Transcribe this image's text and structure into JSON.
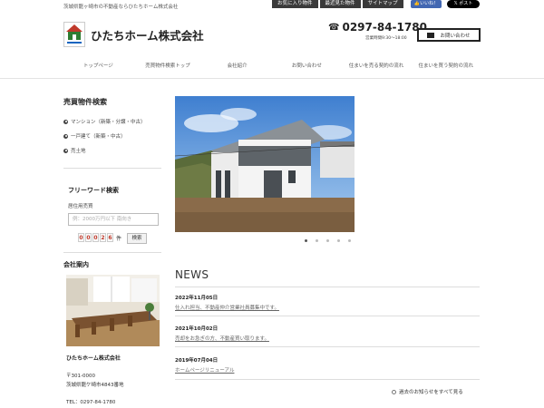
{
  "header": {
    "tagline": "茨城県龍ヶ崎市の不動産ならひたちホーム株式会社",
    "top_buttons": [
      "お気に入り物件",
      "最近見た物件",
      "サイトマップ"
    ],
    "fb_like": "いいね！",
    "x_post": "ポスト",
    "company_name": "ひたちホーム株式会社",
    "phone": "0297-84-1780",
    "hours": "営業時間9:30～18:00",
    "contact_label": "お問い合わせ"
  },
  "nav": {
    "items": [
      "トップページ",
      "売買物件検索トップ",
      "会社紹介",
      "お問い合わせ",
      "住まいを売る契約の流れ",
      "住まいを買う契約の流れ"
    ]
  },
  "sidebar": {
    "search_title": "売買物件検索",
    "categories": [
      "マンション（新築・分譲・中古）",
      "一戸建て（新築・中古）",
      "売土地"
    ],
    "freeword_title": "フリーワード検索",
    "freeword_label": "居住用売買",
    "freeword_placeholder": "例：2000万円以下 南向き",
    "counter_digits": [
      "0",
      "0",
      "0",
      "2",
      "6"
    ],
    "counter_unit": "件",
    "search_button": "検索",
    "company_title": "会社案内",
    "company_name": "ひたちホーム株式会社",
    "zip": "〒301-0000",
    "address": "茨城県龍ケ崎市4843番地",
    "tel": "TEL：0297-84-1780"
  },
  "slider": {
    "total_dots": 5,
    "active_index": 0
  },
  "news": {
    "title": "NEWS",
    "items": [
      {
        "date": "2022年11月05日",
        "text": "仕入れ担当、不動産仲介営業社員募集中です。"
      },
      {
        "date": "2021年10月02日",
        "text": "売却をお急ぎの方、不動産買い取ります。"
      },
      {
        "date": "2019年07月04日",
        "text": "ホームページリニューアル"
      }
    ],
    "more_label": "過去のお知らせをすべて見る"
  },
  "colors": {
    "accent": "#222222",
    "counter_digit": "#c0392b",
    "fb": "#4267b2"
  }
}
